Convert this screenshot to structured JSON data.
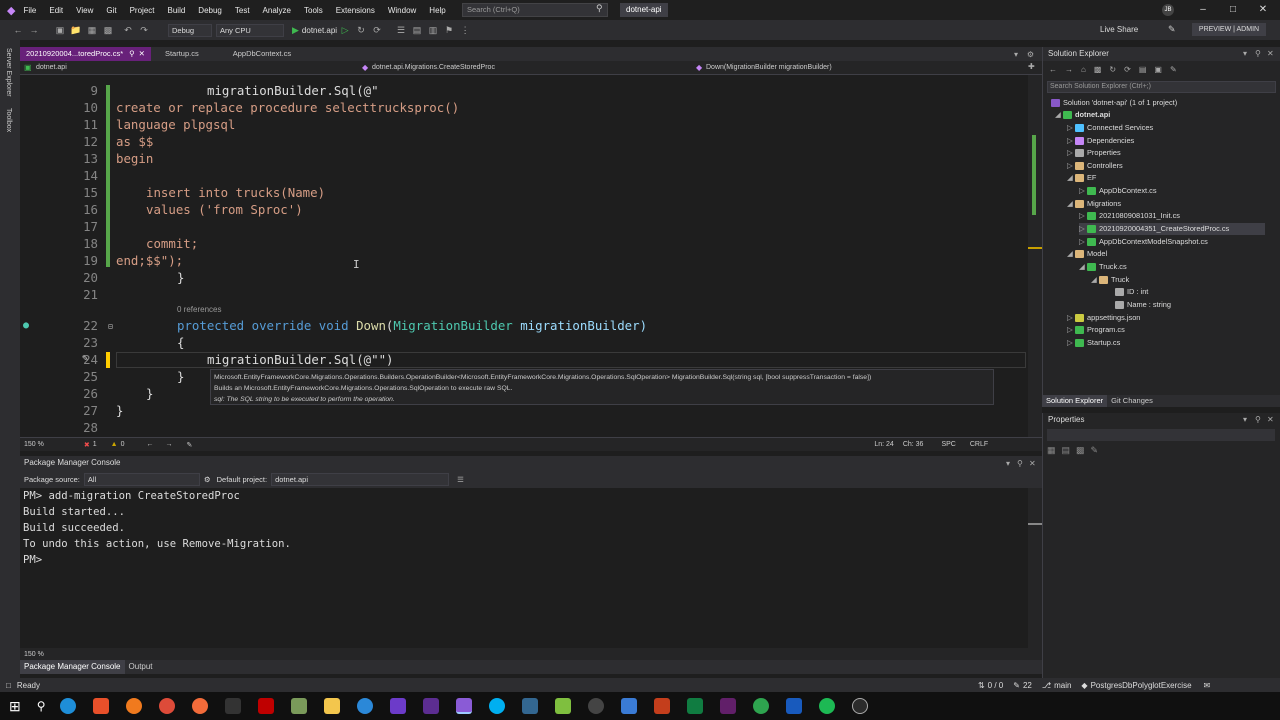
{
  "titlebar": {
    "menus": [
      "File",
      "Edit",
      "View",
      "Git",
      "Project",
      "Build",
      "Debug",
      "Test",
      "Analyze",
      "Tools",
      "Extensions",
      "Window",
      "Help"
    ],
    "search_placeholder": "Search (Ctrl+Q)",
    "project_name": "dotnet-api",
    "user_initials": "JB",
    "live_share": "Live Share",
    "preview": "PREVIEW | ADMIN"
  },
  "toolbar": {
    "config": "Debug",
    "platform": "Any CPU",
    "run_target": "dotnet.api"
  },
  "left_strip": {
    "items": [
      "Server Explorer",
      "Toolbox"
    ]
  },
  "editor": {
    "tabs": [
      {
        "label": "20210920004...toredProc.cs*",
        "active": true
      },
      {
        "label": "Startup.cs",
        "active": false
      },
      {
        "label": "AppDbContext.cs",
        "active": false
      }
    ],
    "nav": {
      "project": "dotnet.api",
      "class": "dotnet.api.Migrations.CreateStoredProc",
      "member": "Down(MigrationBuilder migrationBuilder)"
    },
    "lines": [
      {
        "n": "9"
      },
      {
        "n": "10"
      },
      {
        "n": "11"
      },
      {
        "n": "12"
      },
      {
        "n": "13"
      },
      {
        "n": "14"
      },
      {
        "n": "15"
      },
      {
        "n": "16"
      },
      {
        "n": "17"
      },
      {
        "n": "18"
      },
      {
        "n": "19"
      },
      {
        "n": "20"
      },
      {
        "n": "21"
      },
      {
        "n": "22"
      },
      {
        "n": "23"
      },
      {
        "n": "24"
      },
      {
        "n": "25"
      },
      {
        "n": "26"
      },
      {
        "n": "27"
      },
      {
        "n": "28"
      }
    ],
    "code": {
      "l9_obj": "migrationBuilder",
      "l9_call": ".Sql(@\"",
      "l10": "create or replace procedure selecttrucksproc()",
      "l11": "language plpgsql",
      "l12": "as $$",
      "l13": "begin",
      "l15": "insert into trucks(Name)",
      "l16": "values ('from Sproc')",
      "l18": "commit;",
      "l19": "end;$$\");",
      "l20": "}",
      "codelens": "0 references",
      "l22_protected": "protected",
      "l22_override": "override",
      "l22_void": "void",
      "l22_down": "Down",
      "l22_open": "(",
      "l22_type": "MigrationBuilder",
      "l22_param": "migrationBuilder)",
      "l23": "{",
      "l24_obj": "migrationBuilder",
      "l24_call": ".Sql(@\"\")",
      "l25": "}",
      "l26": "}",
      "l27": "}"
    },
    "tooltip": {
      "line1": "Microsoft.EntityFrameworkCore.Migrations.Operations.Builders.OperationBuilder<Microsoft.EntityFrameworkCore.Migrations.Operations.SqlOperation> MigrationBuilder.Sql(string sql, [bool suppressTransaction = false])",
      "line2": "Builds an Microsoft.EntityFrameworkCore.Migrations.Operations.SqlOperation to execute raw SQL.",
      "line3": "sql: The SQL string to be executed to perform the operation."
    },
    "status": {
      "zoom": "150 %",
      "errors": "1",
      "warnings": "0",
      "position": "Ln: 24",
      "column": "Ch: 36",
      "spc": "SPC",
      "crlf": "CRLF"
    }
  },
  "pmc": {
    "title": "Package Manager Console",
    "source_label": "Package source:",
    "source_value": "All",
    "default_project_label": "Default project:",
    "default_project_value": "dotnet.api",
    "output": [
      "PM> add-migration CreateStoredProc",
      "Build started...",
      "Build succeeded.",
      "To undo this action, use Remove-Migration.",
      "PM>"
    ],
    "zoom": "150 %",
    "tabs": [
      "Package Manager Console",
      "Output"
    ]
  },
  "solution_explorer": {
    "title": "Solution Explorer",
    "search_placeholder": "Search Solution Explorer (Ctrl+;)",
    "items": [
      "Solution 'dotnet-api' (1 of 1 project)",
      "dotnet.api",
      "Connected Services",
      "Dependencies",
      "Properties",
      "Controllers",
      "EF",
      "AppDbContext.cs",
      "Migrations",
      "20210809081031_Init.cs",
      "20210920004351_CreateStoredProc.cs",
      "AppDbContextModelSnapshot.cs",
      "Model",
      "Truck.cs",
      "Truck",
      "ID : int",
      "Name : string",
      "appsettings.json",
      "Program.cs",
      "Startup.cs"
    ],
    "tabs": [
      "Solution Explorer",
      "Git Changes"
    ]
  },
  "properties": {
    "title": "Properties"
  },
  "statusbar": {
    "ready": "Ready",
    "changes": "0 / 0",
    "edits": "22",
    "branch": "main",
    "repo": "PostgresDbPolyglotExercise"
  },
  "colors": {
    "accent": "#68217a",
    "keyword": "#569cd6",
    "string": "#d69d85",
    "type": "#4ec9b0",
    "method": "#dcdcaa"
  }
}
